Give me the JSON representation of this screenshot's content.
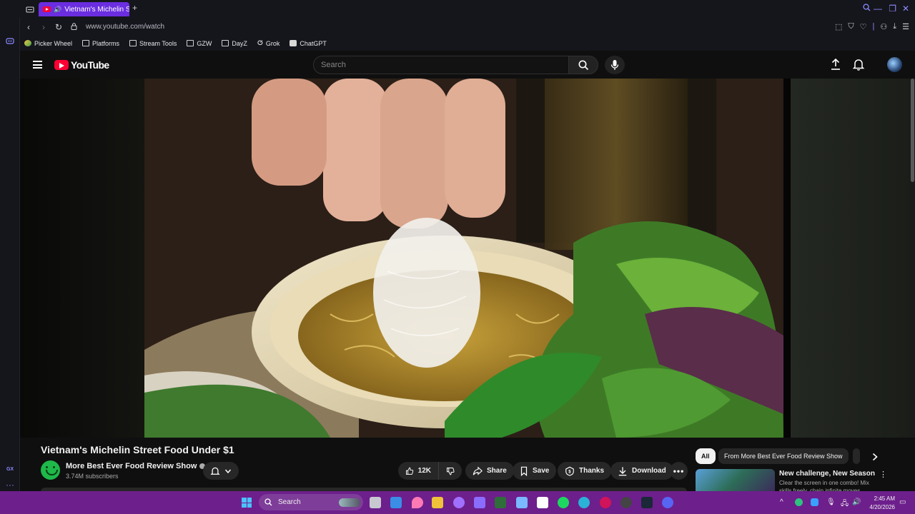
{
  "browser": {
    "tab_title": "Vietnam's Michelin Stre",
    "url": "www.youtube.com/watch",
    "bookmarks": [
      {
        "label": "Picker Wheel",
        "icon": "picker-wheel-icon"
      },
      {
        "label": "Platforms",
        "icon": "folder-icon"
      },
      {
        "label": "Stream Tools",
        "icon": "folder-icon"
      },
      {
        "label": "GZW",
        "icon": "folder-icon"
      },
      {
        "label": "DayZ",
        "icon": "folder-icon"
      },
      {
        "label": "Grok",
        "icon": "grok-icon"
      },
      {
        "label": "ChatGPT",
        "icon": "chatgpt-icon"
      }
    ],
    "sidebar_label": "GX"
  },
  "youtube": {
    "logo_text": "YouTube",
    "search_placeholder": "Search"
  },
  "video": {
    "title": "Vietnam's Michelin Street Food Under $1",
    "channel": "More Best Ever Food Review Show",
    "subscribers": "3.74M subscribers",
    "likes": "12K",
    "actions": {
      "share": "Share",
      "save": "Save",
      "thanks": "Thanks",
      "download": "Download"
    }
  },
  "recommendations": {
    "chips": [
      "All",
      "From More Best Ever Food Review Show"
    ],
    "first": {
      "title": "New challenge, New Season",
      "description": "Clear the screen in one combo! Mix skills freely, chain infinite moves"
    }
  },
  "taskbar": {
    "search_label": "Search",
    "time": "2:45 AM",
    "date": "4/20/2026"
  },
  "colors": {
    "accent_purple": "#6a2de0",
    "taskbar": "#6d1f8c",
    "yt_red": "#ff0033"
  }
}
